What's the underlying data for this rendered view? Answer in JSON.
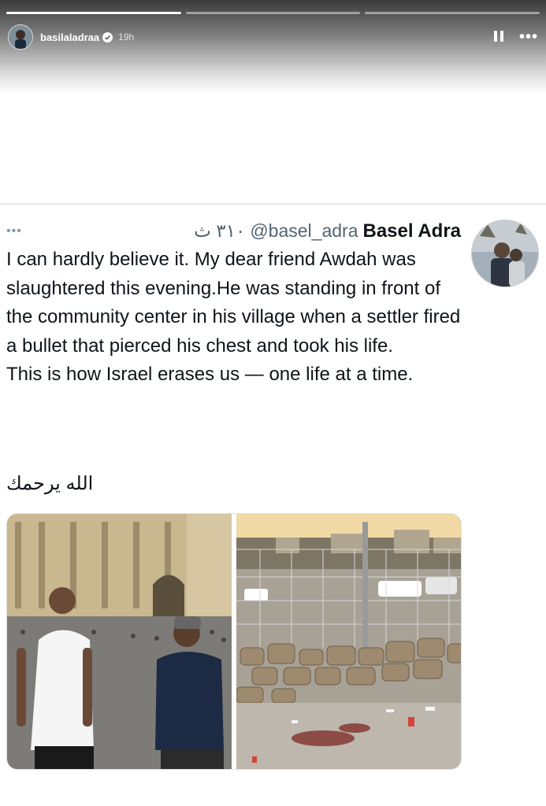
{
  "story": {
    "username": "basilaladraa",
    "time": "19h",
    "progress": [
      1.0,
      0.0,
      0.0
    ],
    "icons": {
      "verified": "verified-badge-icon",
      "pause": "pause-icon",
      "more": "more-horizontal-icon"
    }
  },
  "tweet": {
    "more": "•••",
    "name": "Basel Adra",
    "handle": "@basel_adra",
    "date": "٣١٠ ث",
    "body": [
      "I can hardly believe it. My dear friend Awdah was slaughtered this evening.He was standing in front of the community center in his village when a settler fired a bullet that pierced his chest and took his life.",
      "This is how Israel erases us — one life at a time."
    ],
    "arabic": "الله يرحمك",
    "photos": [
      "photo-two-men-at-vatican",
      "photo-village-fence-blood-stain"
    ]
  },
  "colors": {
    "accent": "#1d9bf0",
    "text": "#0f1419",
    "muted": "#536471"
  }
}
